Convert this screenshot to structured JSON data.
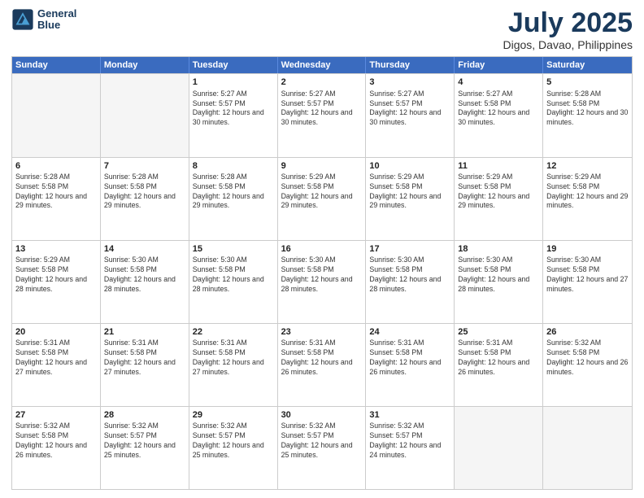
{
  "logo": {
    "line1": "General",
    "line2": "Blue"
  },
  "title": "July 2025",
  "subtitle": "Digos, Davao, Philippines",
  "header_days": [
    "Sunday",
    "Monday",
    "Tuesday",
    "Wednesday",
    "Thursday",
    "Friday",
    "Saturday"
  ],
  "weeks": [
    [
      {
        "day": "",
        "empty": true
      },
      {
        "day": "",
        "empty": true
      },
      {
        "day": "1",
        "sunrise": "5:27 AM",
        "sunset": "5:57 PM",
        "daylight": "12 hours and 30 minutes."
      },
      {
        "day": "2",
        "sunrise": "5:27 AM",
        "sunset": "5:57 PM",
        "daylight": "12 hours and 30 minutes."
      },
      {
        "day": "3",
        "sunrise": "5:27 AM",
        "sunset": "5:57 PM",
        "daylight": "12 hours and 30 minutes."
      },
      {
        "day": "4",
        "sunrise": "5:27 AM",
        "sunset": "5:58 PM",
        "daylight": "12 hours and 30 minutes."
      },
      {
        "day": "5",
        "sunrise": "5:28 AM",
        "sunset": "5:58 PM",
        "daylight": "12 hours and 30 minutes."
      }
    ],
    [
      {
        "day": "6",
        "sunrise": "5:28 AM",
        "sunset": "5:58 PM",
        "daylight": "12 hours and 29 minutes."
      },
      {
        "day": "7",
        "sunrise": "5:28 AM",
        "sunset": "5:58 PM",
        "daylight": "12 hours and 29 minutes."
      },
      {
        "day": "8",
        "sunrise": "5:28 AM",
        "sunset": "5:58 PM",
        "daylight": "12 hours and 29 minutes."
      },
      {
        "day": "9",
        "sunrise": "5:29 AM",
        "sunset": "5:58 PM",
        "daylight": "12 hours and 29 minutes."
      },
      {
        "day": "10",
        "sunrise": "5:29 AM",
        "sunset": "5:58 PM",
        "daylight": "12 hours and 29 minutes."
      },
      {
        "day": "11",
        "sunrise": "5:29 AM",
        "sunset": "5:58 PM",
        "daylight": "12 hours and 29 minutes."
      },
      {
        "day": "12",
        "sunrise": "5:29 AM",
        "sunset": "5:58 PM",
        "daylight": "12 hours and 29 minutes."
      }
    ],
    [
      {
        "day": "13",
        "sunrise": "5:29 AM",
        "sunset": "5:58 PM",
        "daylight": "12 hours and 28 minutes."
      },
      {
        "day": "14",
        "sunrise": "5:30 AM",
        "sunset": "5:58 PM",
        "daylight": "12 hours and 28 minutes."
      },
      {
        "day": "15",
        "sunrise": "5:30 AM",
        "sunset": "5:58 PM",
        "daylight": "12 hours and 28 minutes."
      },
      {
        "day": "16",
        "sunrise": "5:30 AM",
        "sunset": "5:58 PM",
        "daylight": "12 hours and 28 minutes."
      },
      {
        "day": "17",
        "sunrise": "5:30 AM",
        "sunset": "5:58 PM",
        "daylight": "12 hours and 28 minutes."
      },
      {
        "day": "18",
        "sunrise": "5:30 AM",
        "sunset": "5:58 PM",
        "daylight": "12 hours and 28 minutes."
      },
      {
        "day": "19",
        "sunrise": "5:30 AM",
        "sunset": "5:58 PM",
        "daylight": "12 hours and 27 minutes."
      }
    ],
    [
      {
        "day": "20",
        "sunrise": "5:31 AM",
        "sunset": "5:58 PM",
        "daylight": "12 hours and 27 minutes."
      },
      {
        "day": "21",
        "sunrise": "5:31 AM",
        "sunset": "5:58 PM",
        "daylight": "12 hours and 27 minutes."
      },
      {
        "day": "22",
        "sunrise": "5:31 AM",
        "sunset": "5:58 PM",
        "daylight": "12 hours and 27 minutes."
      },
      {
        "day": "23",
        "sunrise": "5:31 AM",
        "sunset": "5:58 PM",
        "daylight": "12 hours and 26 minutes."
      },
      {
        "day": "24",
        "sunrise": "5:31 AM",
        "sunset": "5:58 PM",
        "daylight": "12 hours and 26 minutes."
      },
      {
        "day": "25",
        "sunrise": "5:31 AM",
        "sunset": "5:58 PM",
        "daylight": "12 hours and 26 minutes."
      },
      {
        "day": "26",
        "sunrise": "5:32 AM",
        "sunset": "5:58 PM",
        "daylight": "12 hours and 26 minutes."
      }
    ],
    [
      {
        "day": "27",
        "sunrise": "5:32 AM",
        "sunset": "5:58 PM",
        "daylight": "12 hours and 26 minutes."
      },
      {
        "day": "28",
        "sunrise": "5:32 AM",
        "sunset": "5:57 PM",
        "daylight": "12 hours and 25 minutes."
      },
      {
        "day": "29",
        "sunrise": "5:32 AM",
        "sunset": "5:57 PM",
        "daylight": "12 hours and 25 minutes."
      },
      {
        "day": "30",
        "sunrise": "5:32 AM",
        "sunset": "5:57 PM",
        "daylight": "12 hours and 25 minutes."
      },
      {
        "day": "31",
        "sunrise": "5:32 AM",
        "sunset": "5:57 PM",
        "daylight": "12 hours and 24 minutes."
      },
      {
        "day": "",
        "empty": true
      },
      {
        "day": "",
        "empty": true
      }
    ]
  ]
}
